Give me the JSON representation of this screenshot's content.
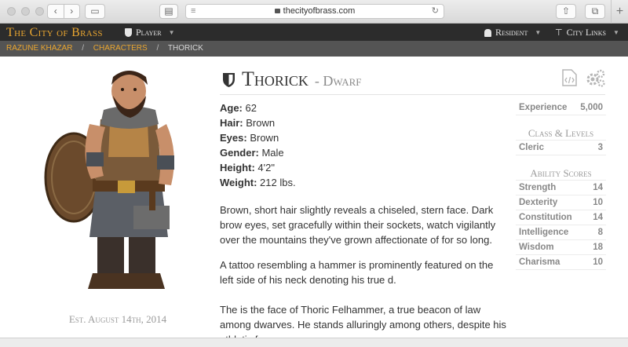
{
  "browser": {
    "url": "thecityofbrass.com",
    "new_tab_label": "+"
  },
  "site": {
    "brand": "The City of Brass",
    "nav": {
      "player": "Player",
      "resident": "Resident",
      "city_links": "City Links"
    }
  },
  "breadcrumb": {
    "items": [
      "Razune Khazar",
      "Characters"
    ],
    "current": "Thorick"
  },
  "character": {
    "name": "Thorick",
    "race": "- Dwarf",
    "established": "Est. August 14th, 2014",
    "attributes": [
      {
        "label": "Age:",
        "value": "62"
      },
      {
        "label": "Hair:",
        "value": "Brown"
      },
      {
        "label": "Eyes:",
        "value": "Brown"
      },
      {
        "label": "Gender:",
        "value": "Male"
      },
      {
        "label": "Height:",
        "value": "4'2\""
      },
      {
        "label": "Weight:",
        "value": "212 lbs."
      }
    ],
    "description": [
      "Brown, short hair slightly reveals a chiseled, stern face. Dark brow eyes, set gracefully within their sockets, watch vigilantly over the mountains they've grown affectionate of for so long.",
      "A tattoo resembling a hammer is prominently featured on the left side of his neck denoting his true d.",
      "The is the face of Thoric Felhammer, a true beacon of law among dwarves. He stands alluringly among others, despite his athletic frame."
    ]
  },
  "stats": {
    "experience_label": "Experience",
    "experience_value": "5,000",
    "class_heading": "Class & Levels",
    "classes": [
      {
        "name": "Cleric",
        "level": "3"
      }
    ],
    "ability_heading": "Ability Scores",
    "abilities": [
      {
        "name": "Strength",
        "value": "14"
      },
      {
        "name": "Dexterity",
        "value": "10"
      },
      {
        "name": "Constitution",
        "value": "14"
      },
      {
        "name": "Intelligence",
        "value": "8"
      },
      {
        "name": "Wisdom",
        "value": "18"
      },
      {
        "name": "Charisma",
        "value": "10"
      }
    ]
  },
  "colors": {
    "accent": "#e8a530",
    "nav_bg": "#2c2c2c",
    "crumb_bg": "#545454"
  }
}
